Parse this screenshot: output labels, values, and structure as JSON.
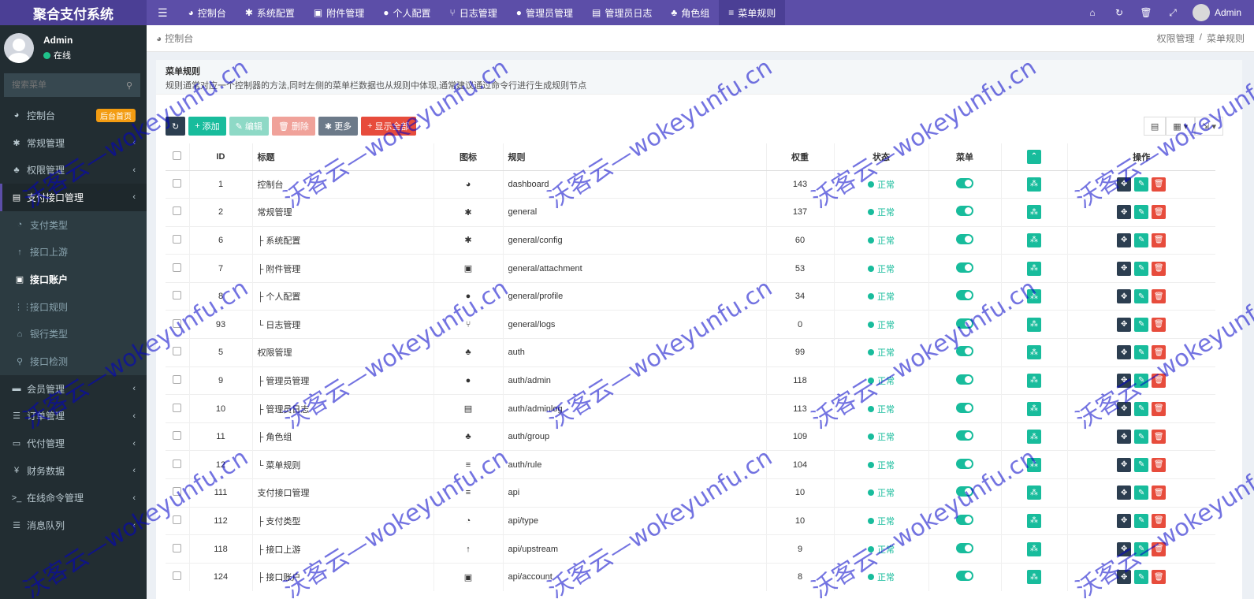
{
  "brand": "聚合支付系统",
  "topnav": [
    {
      "icon": "dashboard-icon",
      "glyph": "◕",
      "label": "控制台"
    },
    {
      "icon": "gear-icon",
      "glyph": "✱",
      "label": "系统配置"
    },
    {
      "icon": "image-icon",
      "glyph": "▣",
      "label": "附件管理"
    },
    {
      "icon": "user-icon",
      "glyph": "●",
      "label": "个人配置"
    },
    {
      "icon": "fork-icon",
      "glyph": "⑂",
      "label": "日志管理"
    },
    {
      "icon": "user-icon",
      "glyph": "●",
      "label": "管理员管理"
    },
    {
      "icon": "list-icon",
      "glyph": "▤",
      "label": "管理员日志"
    },
    {
      "icon": "group-icon",
      "glyph": "♣",
      "label": "角色组"
    },
    {
      "icon": "bars-icon",
      "glyph": "≡",
      "label": "菜单规则"
    }
  ],
  "topright_user": "Admin",
  "sidebar": {
    "user_name": "Admin",
    "user_status": "在线",
    "search_placeholder": "搜索菜单",
    "items": [
      {
        "label": "控制台",
        "glyph": "◕",
        "icon": "dashboard-icon",
        "badge": "后台首页"
      },
      {
        "label": "常规管理",
        "glyph": "✱",
        "icon": "gears-icon",
        "arrow": "‹"
      },
      {
        "label": "权限管理",
        "glyph": "♣",
        "icon": "group-icon",
        "arrow": "‹"
      },
      {
        "label": "支付接口管理",
        "glyph": "▤",
        "icon": "bars-icon",
        "arrow": "‹",
        "open": true
      },
      {
        "label": "支付类型",
        "glyph": "◔",
        "icon": "globe-icon",
        "sub": true
      },
      {
        "label": "接口上游",
        "glyph": "↑",
        "icon": "arrow-up-icon",
        "sub": true
      },
      {
        "label": "接口账户",
        "glyph": "▣",
        "icon": "account-icon",
        "sub": true,
        "current": true
      },
      {
        "label": "接口规则",
        "glyph": "⋮⋮",
        "icon": "rules-icon",
        "sub": true
      },
      {
        "label": "银行类型",
        "glyph": "⌂",
        "icon": "bank-icon",
        "sub": true
      },
      {
        "label": "接口检测",
        "glyph": "⚲",
        "icon": "search-icon",
        "sub": true
      },
      {
        "label": "会员管理",
        "glyph": "▬",
        "icon": "member-icon",
        "arrow": "‹"
      },
      {
        "label": "订单管理",
        "glyph": "☰",
        "icon": "list-icon",
        "arrow": "‹"
      },
      {
        "label": "代付管理",
        "glyph": "▭",
        "icon": "money-icon",
        "arrow": "‹"
      },
      {
        "label": "财务数据",
        "glyph": "¥",
        "icon": "yen-icon",
        "arrow": "‹"
      },
      {
        "label": "在线命令管理",
        "glyph": ">_",
        "icon": "terminal-icon",
        "arrow": "‹"
      },
      {
        "label": "消息队列",
        "glyph": "☰",
        "icon": "queue-icon",
        "arrow": "‹"
      }
    ]
  },
  "crumb": {
    "left": "控制台",
    "right": [
      "权限管理",
      "/",
      "菜单规则"
    ]
  },
  "tip": {
    "title": "菜单规则",
    "desc": "规则通常对应一个控制器的方法,同时左侧的菜单栏数据也从规则中体现,通常建议通过命令行进行生成规则节点"
  },
  "toolbar": {
    "add": "添加",
    "edit": "编辑",
    "del": "删除",
    "more": "更多",
    "showall": "显示全部"
  },
  "columns": {
    "id": "ID",
    "title": "标题",
    "icon": "图标",
    "rule": "规则",
    "weigh": "权重",
    "status": "状态",
    "menu": "菜单",
    "op": "操作"
  },
  "rows": [
    {
      "id": "1",
      "title": "控制台",
      "glyph": "◕",
      "rule": "dashboard",
      "weigh": "143",
      "status": "正常"
    },
    {
      "id": "2",
      "title": "常规管理",
      "glyph": "✱",
      "rule": "general",
      "weigh": "137",
      "status": "正常"
    },
    {
      "id": "6",
      "title": "├ 系统配置",
      "glyph": "✱",
      "rule": "general/config",
      "weigh": "60",
      "status": "正常"
    },
    {
      "id": "7",
      "title": "├ 附件管理",
      "glyph": "▣",
      "rule": "general/attachment",
      "weigh": "53",
      "status": "正常"
    },
    {
      "id": "8",
      "title": "├ 个人配置",
      "glyph": "●",
      "rule": "general/profile",
      "weigh": "34",
      "status": "正常"
    },
    {
      "id": "93",
      "title": "└ 日志管理",
      "glyph": "⑂",
      "rule": "general/logs",
      "weigh": "0",
      "status": "正常"
    },
    {
      "id": "5",
      "title": "权限管理",
      "glyph": "♣",
      "rule": "auth",
      "weigh": "99",
      "status": "正常"
    },
    {
      "id": "9",
      "title": "├ 管理员管理",
      "glyph": "●",
      "rule": "auth/admin",
      "weigh": "118",
      "status": "正常"
    },
    {
      "id": "10",
      "title": "├ 管理员日志",
      "glyph": "▤",
      "rule": "auth/adminlog",
      "weigh": "113",
      "status": "正常"
    },
    {
      "id": "11",
      "title": "├ 角色组",
      "glyph": "♣",
      "rule": "auth/group",
      "weigh": "109",
      "status": "正常"
    },
    {
      "id": "12",
      "title": "└ 菜单规则",
      "glyph": "≡",
      "rule": "auth/rule",
      "weigh": "104",
      "status": "正常"
    },
    {
      "id": "111",
      "title": "支付接口管理",
      "glyph": "≡",
      "rule": "api",
      "weigh": "10",
      "status": "正常"
    },
    {
      "id": "112",
      "title": "├ 支付类型",
      "glyph": "◔",
      "rule": "api/type",
      "weigh": "10",
      "status": "正常"
    },
    {
      "id": "118",
      "title": "├ 接口上游",
      "glyph": "↑",
      "rule": "api/upstream",
      "weigh": "9",
      "status": "正常"
    },
    {
      "id": "124",
      "title": "├ 接口账户",
      "glyph": "▣",
      "rule": "api/account",
      "weigh": "8",
      "status": "正常"
    }
  ],
  "watermark": "沃客云—wokeyunfu.cn",
  "colors": {
    "topbar": "#5c4ea8",
    "sidebar": "#222d32",
    "success": "#18bc9c",
    "danger": "#e74c3c",
    "dark": "#2c3e50"
  }
}
